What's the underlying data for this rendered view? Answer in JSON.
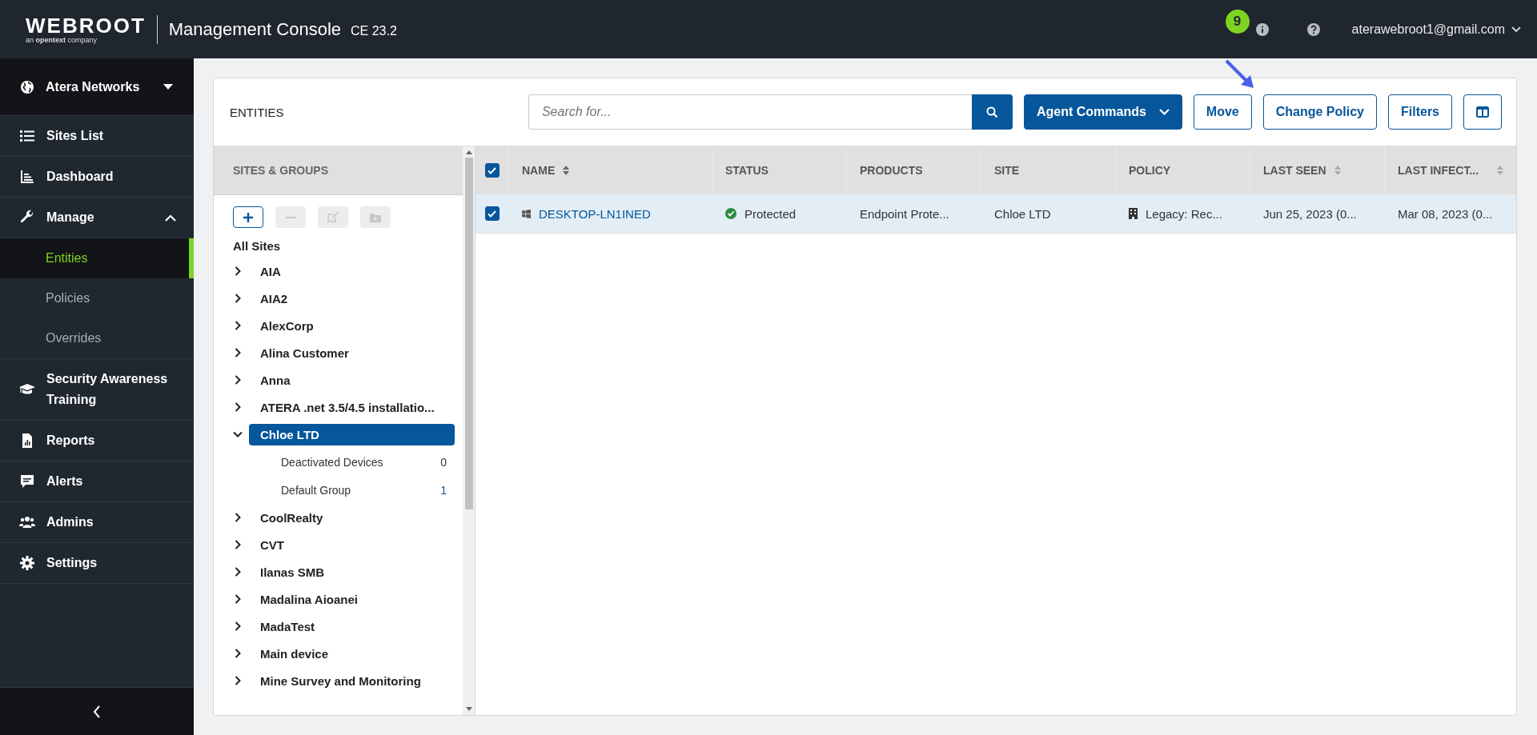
{
  "header": {
    "brand": "WEBROOT",
    "brand_sub": "an **opentext** company",
    "title": "Management Console",
    "version": "CE 23.2",
    "badge": "9",
    "user": "aterawebroot1@gmail.com"
  },
  "sidebar": {
    "org": "Atera Networks",
    "items": [
      {
        "kind": "nav",
        "label": "Sites List",
        "selected": false
      },
      {
        "kind": "nav",
        "label": "Dashboard",
        "selected": false
      },
      {
        "kind": "group",
        "label": "Manage",
        "expanded": true,
        "selected": false
      },
      {
        "kind": "sub",
        "label": "Entities",
        "selected": true
      },
      {
        "kind": "sub",
        "label": "Policies",
        "selected": false
      },
      {
        "kind": "sub",
        "label": "Overrides",
        "selected": false
      },
      {
        "kind": "nav",
        "label": "Security Awareness Training",
        "selected": false
      },
      {
        "kind": "nav",
        "label": "Reports",
        "selected": false
      },
      {
        "kind": "nav",
        "label": "Alerts",
        "selected": false
      },
      {
        "kind": "nav",
        "label": "Admins",
        "selected": false
      },
      {
        "kind": "nav",
        "label": "Settings",
        "selected": false
      }
    ]
  },
  "entities": {
    "title": "ENTITIES",
    "search": {
      "placeholder": "Search for..."
    },
    "agent_button": "Agent Commands",
    "buttons": [
      "Move",
      "Change Policy",
      "Filters"
    ]
  },
  "tree": {
    "heading": "SITES & GROUPS",
    "root": "All Sites",
    "sites": [
      {
        "label": "AIA",
        "expanded": false,
        "selected": false
      },
      {
        "label": "AIA2",
        "expanded": false,
        "selected": false
      },
      {
        "label": "AlexCorp",
        "expanded": false,
        "selected": false
      },
      {
        "label": "Alina Customer",
        "expanded": false,
        "selected": false
      },
      {
        "label": "Anna",
        "expanded": false,
        "selected": false
      },
      {
        "label": "ATERA .net 3.5/4.5 installatio...",
        "expanded": false,
        "selected": false
      },
      {
        "label": "Chloe LTD",
        "expanded": true,
        "selected": true,
        "children": [
          {
            "label": "Deactivated Devices",
            "count": "0"
          },
          {
            "label": "Default Group",
            "count": "1"
          }
        ]
      },
      {
        "label": "CoolRealty",
        "expanded": false,
        "selected": false
      },
      {
        "label": "CVT",
        "expanded": false,
        "selected": false
      },
      {
        "label": "Ilanas SMB",
        "expanded": false,
        "selected": false
      },
      {
        "label": "Madalina Aioanei",
        "expanded": false,
        "selected": false
      },
      {
        "label": "MadaTest",
        "expanded": false,
        "selected": false
      },
      {
        "label": "Main device",
        "expanded": false,
        "selected": false
      },
      {
        "label": "Mine Survey and Monitoring",
        "expanded": false,
        "selected": false
      }
    ]
  },
  "table": {
    "all_checked": true,
    "columns": [
      {
        "label": "NAME",
        "sortable": true
      },
      {
        "label": "STATUS",
        "sortable": false
      },
      {
        "label": "PRODUCTS",
        "sortable": false
      },
      {
        "label": "SITE",
        "sortable": false
      },
      {
        "label": "POLICY",
        "sortable": false
      },
      {
        "label": "LAST SEEN",
        "sortable": true
      },
      {
        "label": "LAST INFECT...",
        "sortable": true
      }
    ],
    "rows": [
      {
        "checked": true,
        "selected": true,
        "name": "DESKTOP-LN1INED",
        "status": "Protected",
        "products": "Endpoint Prote...",
        "site": "Chloe LTD",
        "policy": "Legacy: Rec...",
        "last_seen": "Jun 25, 2023 (0...",
        "last_infected": "Mar 08, 2023 (0..."
      }
    ]
  }
}
